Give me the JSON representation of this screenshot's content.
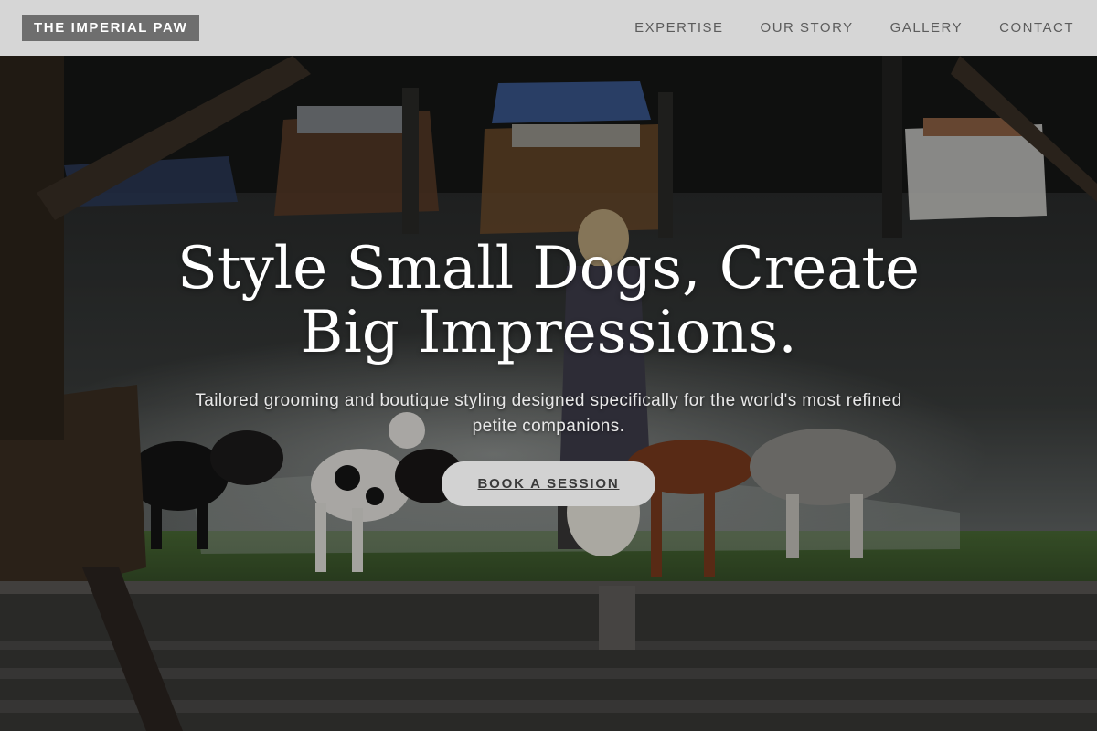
{
  "brand": {
    "name": "THE IMPERIAL PAW"
  },
  "nav": {
    "items": [
      {
        "label": "EXPERTISE"
      },
      {
        "label": "OUR STORY"
      },
      {
        "label": "GALLERY"
      },
      {
        "label": "CONTACT"
      }
    ]
  },
  "hero": {
    "headline": "Style Small Dogs, Create Big Impressions.",
    "subhead": "Tailored grooming and boutique styling designed specifically for the world's most refined petite companions.",
    "cta_label": "BOOK A SESSION",
    "background_photo": "woman walking a pack of dogs on a grassy riverbank by a marina with moored boats"
  },
  "colors": {
    "header_bg": "#d6d6d6",
    "logo_bg": "#6e6e6e",
    "nav_text": "#5c5c5c",
    "cta_bg": "#d2d2d2",
    "cta_text": "#3a3a3a"
  }
}
